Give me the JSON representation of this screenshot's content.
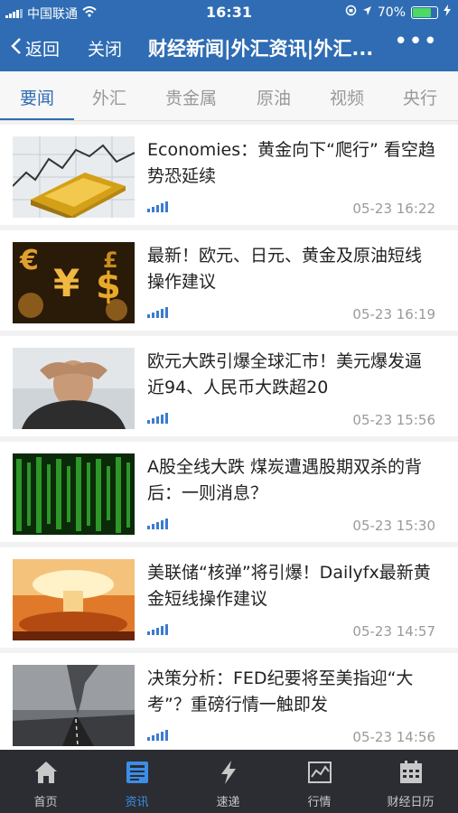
{
  "status_bar": {
    "carrier": "中国联通",
    "time": "16:31",
    "battery": "70%"
  },
  "nav": {
    "back_label": "返回",
    "close_label": "关闭",
    "title": "财经新闻|外汇资讯|外汇...",
    "more_label": "•••"
  },
  "tabs": [
    "要闻",
    "外汇",
    "贵金属",
    "原油",
    "视频",
    "央行"
  ],
  "active_tab": 0,
  "news": [
    {
      "title": "Economies：黄金向下“爬行” 看空趋势恐延续",
      "time": "05-23 16:22",
      "image": "gold-bar-chart"
    },
    {
      "title": "最新！欧元、日元、黄金及原油短线操作建议",
      "time": "05-23 16:19",
      "image": "currency-symbols"
    },
    {
      "title": "欧元大跌引爆全球汇市！美元爆发逼近94、人民币大跌超20",
      "time": "05-23 15:56",
      "image": "stressed-man"
    },
    {
      "title": "A股全线大跌 煤炭遭遇股期双杀的背后：一则消息？",
      "time": "05-23 15:30",
      "image": "green-stock-board"
    },
    {
      "title": "美联储“核弹”将引爆！Dailyfx最新黄金短线操作建议",
      "time": "05-23 14:57",
      "image": "nuclear-explosion"
    },
    {
      "title": "决策分析：FED纪要将至美指迎“大考”？重磅行情一触即发",
      "time": "05-23 14:56",
      "image": "tornado-road"
    }
  ],
  "tabbar": [
    {
      "label": "首页",
      "icon": "home-icon"
    },
    {
      "label": "资讯",
      "icon": "news-icon"
    },
    {
      "label": "速递",
      "icon": "lightning-icon"
    },
    {
      "label": "行情",
      "icon": "chart-icon"
    },
    {
      "label": "财经日历",
      "icon": "calendar-icon"
    }
  ],
  "active_tabbar": 1,
  "colors": {
    "accent": "#2f6cb3",
    "tabbar_bg": "#2b2d33",
    "tabbar_active": "#3b8ee8"
  }
}
